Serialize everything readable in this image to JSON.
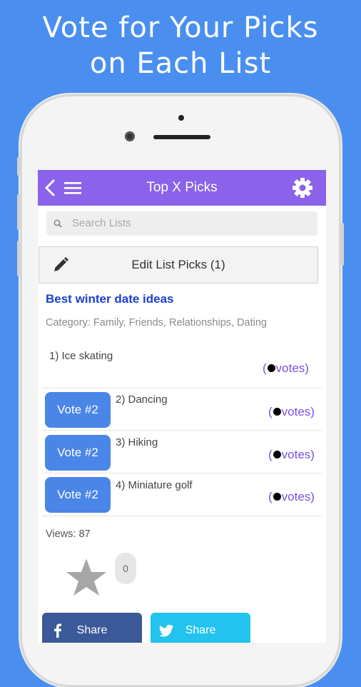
{
  "promo": {
    "line1": "Vote for Your Picks",
    "line2": "on Each List"
  },
  "colors": {
    "background": "#4a8ff0",
    "appbar": "#8a63ea",
    "vote_button": "#4a85e8",
    "list_title": "#1a3fcf",
    "votes_text": "#7a4fe0",
    "facebook": "#3b5998",
    "twitter": "#22c3ee"
  },
  "appbar": {
    "title": "Top X Picks",
    "icons": [
      "back-chevron-icon",
      "hamburger-menu-icon",
      "settings-gear-icon"
    ]
  },
  "search": {
    "placeholder": "Search Lists",
    "icon": "search-icon"
  },
  "edit_button": {
    "label": "Edit List Picks (1)",
    "icon": "pencil-icon"
  },
  "list": {
    "title": "Best winter date ideas",
    "category": "Category: Family, Friends, Relationships, Dating",
    "picks": [
      {
        "text": "1) Ice skating",
        "votes_prefix": "(",
        "votes_suffix": "votes)",
        "has_vote_button": false
      },
      {
        "text": "2) Dancing",
        "votes_prefix": "(",
        "votes_suffix": "votes)",
        "has_vote_button": true,
        "vote_label": "Vote #2"
      },
      {
        "text": "3) Hiking",
        "votes_prefix": "(",
        "votes_suffix": "votes)",
        "has_vote_button": true,
        "vote_label": "Vote #2"
      },
      {
        "text": "4) Miniature golf",
        "votes_prefix": "(",
        "votes_suffix": "votes)",
        "has_vote_button": true,
        "vote_label": "Vote #2"
      }
    ]
  },
  "stats": {
    "views": "Views: 87",
    "favorite_count": "0",
    "favorite_icon": "star-icon"
  },
  "share": {
    "facebook_label": "Share",
    "twitter_label": "Share",
    "facebook_icon": "facebook-icon",
    "twitter_icon": "twitter-bird-icon"
  }
}
